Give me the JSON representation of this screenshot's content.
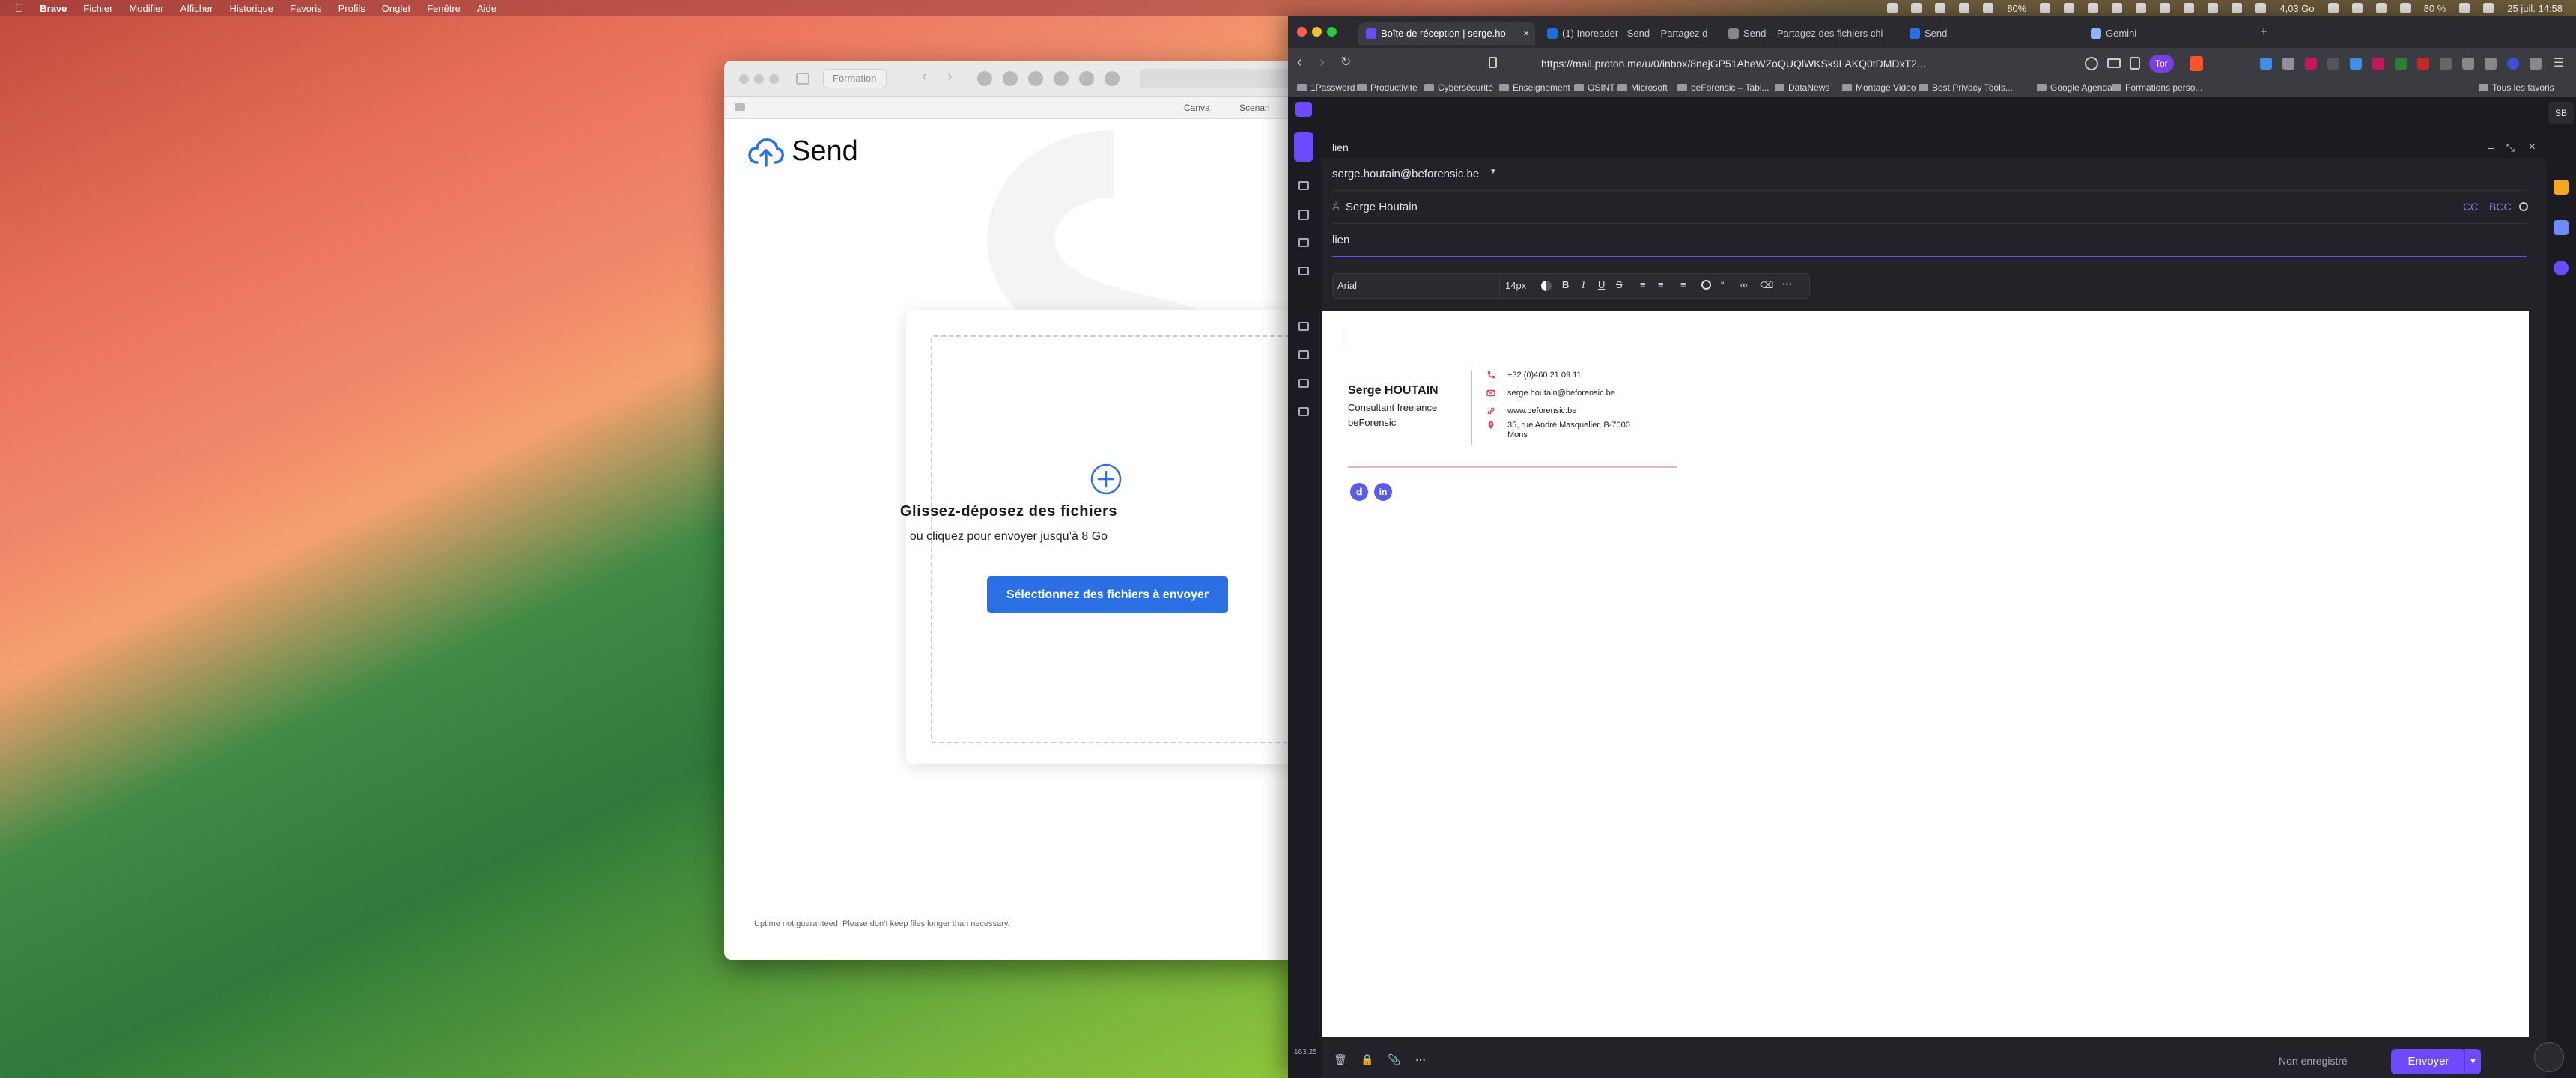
{
  "menubar": {
    "app_name": "Brave",
    "items": [
      "Fichier",
      "Modifier",
      "Afficher",
      "Historique",
      "Favoris",
      "Profils",
      "Onglet",
      "Fenêtre",
      "Aide"
    ],
    "volume": "80%",
    "memory": "4,03 Go",
    "battery": "80 %",
    "datetime": "25 juil. 14:58"
  },
  "send_window": {
    "tab_group": "Formation",
    "bookmarks": [
      "Canva",
      "Scenari"
    ],
    "brand": "Send",
    "drop_title": "Glissez-déposez des fichiers",
    "drop_subtitle": "ou cliquez pour envoyer jusqu’à 8 Go",
    "select_button": "Sélectionnez des fichiers à envoyer",
    "uptime_note": "Uptime not guaranteed. Please don’t keep files longer than necessary."
  },
  "browser": {
    "tabs": [
      {
        "label": "Boîte de réception | serge.ho",
        "color": "#6d4aff",
        "active": true
      },
      {
        "label": "(1) Inoreader - Send – Partagez d",
        "color": "#1d6ed8",
        "active": false
      },
      {
        "label": "Send – Partagez des fichiers chi",
        "color": "#888888",
        "active": false
      },
      {
        "label": "Send",
        "color": "#2b6fe5",
        "active": false
      },
      {
        "label": "Gemini",
        "color": "#8ab4f8",
        "active": false
      }
    ],
    "new_tab": "+",
    "url": "https://mail.proton.me/u/0/inbox/8nejGP51AheWZoQUQlWKSk9LAKQ0tDMDxT2...",
    "tor_label": "Tor",
    "bookmarks": [
      "1Password",
      "Productivite",
      "Cybersécurité",
      "Enseignement",
      "OSINT",
      "Microsoft",
      "beForensic – Tabl...",
      "DataNews",
      "Montage Video",
      "Best Privacy Tools...",
      "Google Agenda",
      "Formations perso..."
    ],
    "all_bookmarks": "Tous les favoris",
    "avatar_initials": "SB"
  },
  "composer": {
    "title": "lien",
    "from": "serge.houtain@beforensic.be",
    "to_label": "À",
    "to_recipient": "Serge Houtain",
    "cc": "CC",
    "bcc": "BCC",
    "subject": "lien",
    "font_family": "Arial",
    "font_size": "14px",
    "unsaved": "Non enregistré",
    "send_button": "Envoyer",
    "footer_small": "163.25"
  },
  "signature": {
    "name": "Serge HOUTAIN",
    "role": "Consultant freelance",
    "company": "beForensic",
    "phone": "+32 (0)460 21 09 11",
    "email": "serge.houtain@beforensic.be",
    "website": "www.beforensic.be",
    "address_line1": "35, rue André Masquelier, B-7000",
    "address_line2": "Mons",
    "accent_color": "#e0405e"
  },
  "colors": {
    "proton_purple": "#6d4aff",
    "send_blue": "#2b6fe5"
  }
}
